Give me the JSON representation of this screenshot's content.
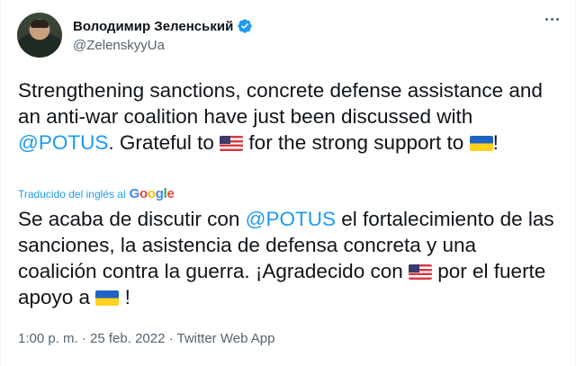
{
  "author": {
    "name": "Володимир Зеленський",
    "handle": "@ZelenskyyUa"
  },
  "tweet": {
    "original": {
      "part1": "Strengthening sanctions, concrete defense assistance and an anti-war coalition have just been discussed with ",
      "mention": "@POTUS",
      "part2": ". Grateful to ",
      "part3": " for the strong support to ",
      "part4": "!"
    },
    "translated_label": "Traducido del inglés al",
    "translation_provider": {
      "letters": [
        "G",
        "o",
        "o",
        "g",
        "l",
        "e"
      ],
      "colors": [
        "#4285f4",
        "#ea4335",
        "#fbbc05",
        "#4285f4",
        "#34a853",
        "#ea4335"
      ]
    },
    "translation": {
      "part1": "Se acaba de discutir con ",
      "mention": "@POTUS",
      "part2": " el fortalecimiento de las sanciones, la asistencia de defensa concreta y una coalición contra la guerra. ¡Agradecido con ",
      "part3": " por el fuerte apoyo a ",
      "part4": " !"
    },
    "meta": "1:00 p. m. · 25 feb. 2022 · Twitter Web App"
  },
  "icons": {
    "verified": "verified-badge-icon",
    "more": "more-options-icon",
    "flag_us": "us-flag-icon",
    "flag_ua": "ukraine-flag-icon"
  },
  "colors": {
    "link": "#1d9bf0",
    "secondary_text": "#536471",
    "primary_text": "#0f1419"
  }
}
